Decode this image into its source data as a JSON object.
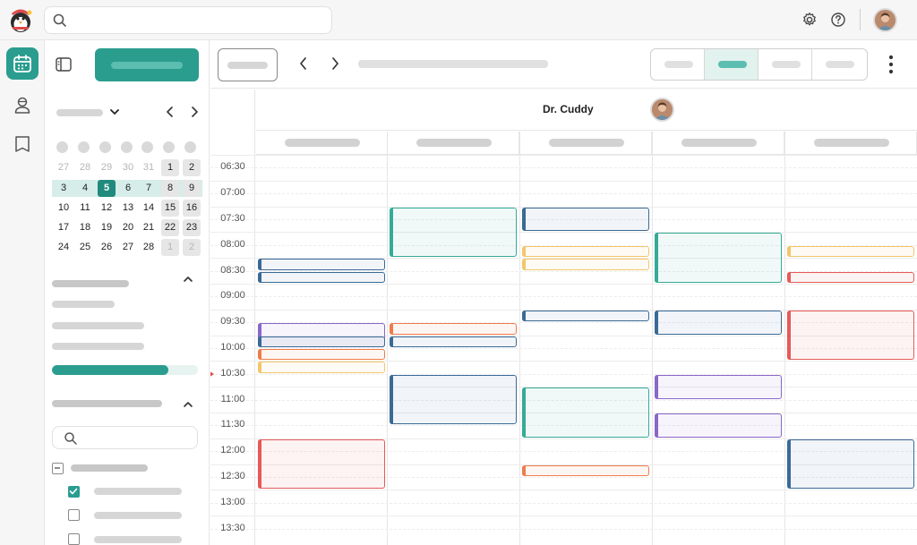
{
  "colors": {
    "accent": "#2a9d8f",
    "blue": "#3a6a96",
    "teal": "#35ab97",
    "yellow": "#f2c66b",
    "orange": "#ef7c4a",
    "purple": "#8a68c8",
    "red": "#e55a58"
  },
  "icons": {
    "logo": "mascot-logo-icon",
    "search": "search-icon",
    "settings": "gear-icon",
    "help": "help-circle-icon",
    "calendar": "calendar-icon",
    "patients": "person-icon",
    "library": "book-icon",
    "sidebar_toggle": "sidebar-toggle-icon"
  },
  "mini_calendar": {
    "weeks": [
      [
        "27",
        "28",
        "29",
        "30",
        "31",
        "1",
        "2"
      ],
      [
        "3",
        "4",
        "5",
        "6",
        "7",
        "8",
        "9"
      ],
      [
        "10",
        "11",
        "12",
        "13",
        "14",
        "15",
        "16"
      ],
      [
        "17",
        "18",
        "19",
        "20",
        "21",
        "22",
        "23"
      ],
      [
        "24",
        "25",
        "26",
        "27",
        "28",
        "1",
        "2"
      ]
    ],
    "today": "5"
  },
  "sidebar": {
    "capacity_fraction": 0.8
  },
  "resource": {
    "name": "Dr. Cuddy"
  },
  "time_slots": [
    "06:30",
    "07:00",
    "07:30",
    "08:00",
    "08:30",
    "09:00",
    "09:30",
    "10:00",
    "10:30",
    "11:00",
    "11:30",
    "12:00",
    "12:30",
    "13:00",
    "13:30"
  ],
  "current_time": "10:30",
  "events": [
    {
      "day": 0,
      "start": "08:30",
      "end": "08:45",
      "color": "blue"
    },
    {
      "day": 0,
      "start": "08:45",
      "end": "09:00",
      "color": "blue"
    },
    {
      "day": 0,
      "start": "09:45",
      "end": "10:15",
      "color": "purple"
    },
    {
      "day": 0,
      "start": "10:00",
      "end": "10:15",
      "color": "blue"
    },
    {
      "day": 0,
      "start": "10:15",
      "end": "10:30",
      "color": "orange"
    },
    {
      "day": 0,
      "start": "10:30",
      "end": "10:45",
      "color": "yellow"
    },
    {
      "day": 0,
      "start": "12:00",
      "end": "13:00",
      "color": "red"
    },
    {
      "day": 1,
      "start": "07:30",
      "end": "08:30",
      "color": "teal"
    },
    {
      "day": 1,
      "start": "09:45",
      "end": "10:00",
      "color": "orange"
    },
    {
      "day": 1,
      "start": "10:00",
      "end": "10:15",
      "color": "blue"
    },
    {
      "day": 1,
      "start": "10:45",
      "end": "11:45",
      "color": "blue"
    },
    {
      "day": 2,
      "start": "07:30",
      "end": "08:00",
      "color": "blue"
    },
    {
      "day": 2,
      "start": "08:15",
      "end": "08:30",
      "color": "yellow"
    },
    {
      "day": 2,
      "start": "08:30",
      "end": "08:45",
      "color": "yellow"
    },
    {
      "day": 2,
      "start": "09:30",
      "end": "09:45",
      "color": "blue"
    },
    {
      "day": 2,
      "start": "11:00",
      "end": "12:00",
      "color": "teal"
    },
    {
      "day": 2,
      "start": "12:30",
      "end": "12:45",
      "color": "orange"
    },
    {
      "day": 3,
      "start": "08:00",
      "end": "09:00",
      "color": "teal"
    },
    {
      "day": 3,
      "start": "09:30",
      "end": "10:00",
      "color": "blue"
    },
    {
      "day": 3,
      "start": "10:45",
      "end": "11:15",
      "color": "purple"
    },
    {
      "day": 3,
      "start": "11:30",
      "end": "12:00",
      "color": "purple"
    },
    {
      "day": 4,
      "start": "08:15",
      "end": "08:30",
      "color": "yellow"
    },
    {
      "day": 4,
      "start": "08:45",
      "end": "09:00",
      "color": "red"
    },
    {
      "day": 4,
      "start": "09:30",
      "end": "10:30",
      "color": "red"
    },
    {
      "day": 4,
      "start": "12:00",
      "end": "13:00",
      "color": "blue"
    }
  ]
}
